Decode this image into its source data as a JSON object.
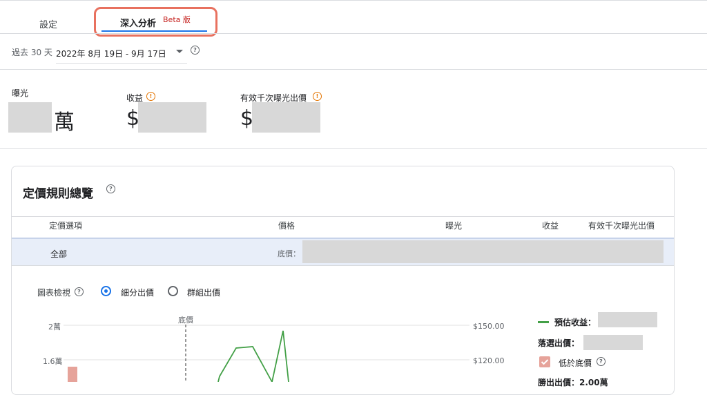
{
  "tabs": [
    {
      "label": "設定"
    },
    {
      "label": "深入分析",
      "badge": "Beta 版"
    }
  ],
  "date_range": {
    "prefix": "過去 30 天",
    "value": "2022年 8月 19日 - 9月 17日"
  },
  "metrics": [
    {
      "label": "曝光",
      "unit": "萬"
    },
    {
      "label": "收益",
      "currency": "$"
    },
    {
      "label": "有效千次曝光出價",
      "currency": "$"
    }
  ],
  "pricing_overview": {
    "title": "定價規則總覽",
    "columns": [
      "定價選項",
      "價格",
      "曝光",
      "收益",
      "有效千次曝光出價"
    ],
    "rows": [
      {
        "option": "全部",
        "price_prefix": "底價："
      }
    ]
  },
  "chart_view": {
    "label": "圖表檢視",
    "options": [
      {
        "label": "細分出價",
        "selected": true
      },
      {
        "label": "群組出價",
        "selected": false
      }
    ]
  },
  "chart_data": {
    "type": "line",
    "left_ticks": [
      "2萬",
      "1.6萬"
    ],
    "right_ticks": [
      "$150.00",
      "$120.00"
    ],
    "floor_marker_label": "底價",
    "legend": {
      "estimated_revenue": "預估收益：",
      "win_bid": "落選出價：",
      "below_floor": "低於底價",
      "partial_line": "勝出出價：2.00萬"
    }
  },
  "colors": {
    "accent": "#1a73e8",
    "line": "#43a047",
    "bar": "#e6a39a",
    "highlight": "#e8715f",
    "warning": "#e37400"
  }
}
